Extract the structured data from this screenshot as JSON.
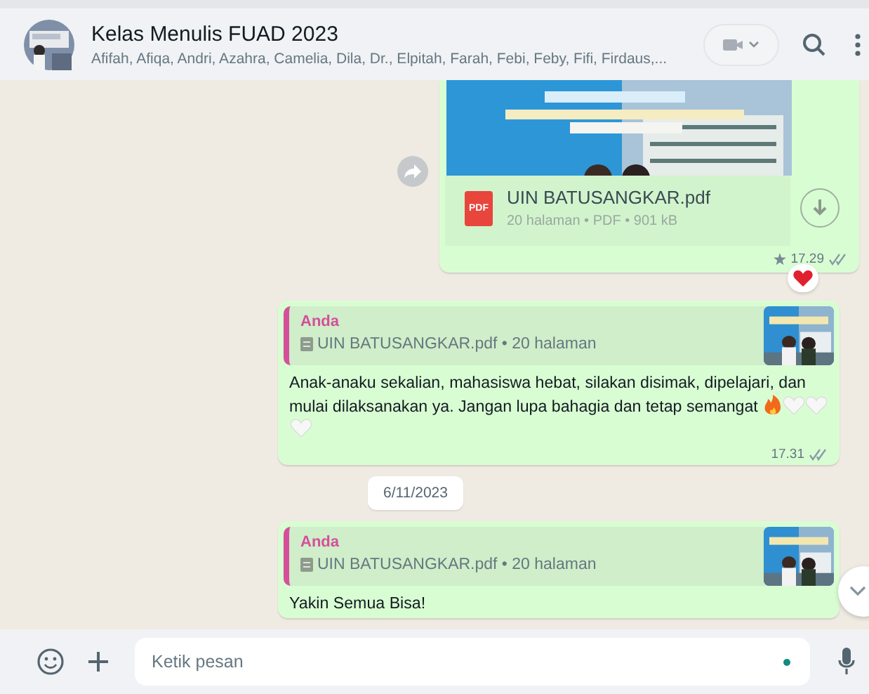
{
  "header": {
    "title": "Kelas Menulis FUAD 2023",
    "members": "Afifah, Afiqa, Andri, Azahra, Camelia, Dila, Dr., Elpitah, Farah, Febi, Feby, Fifi, Firdaus,..."
  },
  "messages": [
    {
      "kind": "document",
      "file_name": "UIN BATUSANGKAR.pdf",
      "file_info": "20 halaman • PDF • 901 kB",
      "file_badge": "PDF",
      "time": "17.29",
      "starred": true,
      "reaction": true
    },
    {
      "kind": "reply",
      "quote_author": "Anda",
      "quote_text": "UIN BATUSANGKAR.pdf • 20 halaman",
      "text": "Anak-anaku sekalian, mahasiswa hebat, silakan disimak, dipelajari, dan mulai dilaksanakan ya. Jangan lupa bahagia dan tetap semangat",
      "emoji_trail": true,
      "time": "17.31"
    },
    {
      "kind": "date",
      "text": "6/11/2023"
    },
    {
      "kind": "reply",
      "quote_author": "Anda",
      "quote_text": "UIN BATUSANGKAR.pdf • 20 halaman",
      "text": "Yakin Semua Bisa!"
    }
  ],
  "composer": {
    "placeholder": "Ketik pesan"
  }
}
